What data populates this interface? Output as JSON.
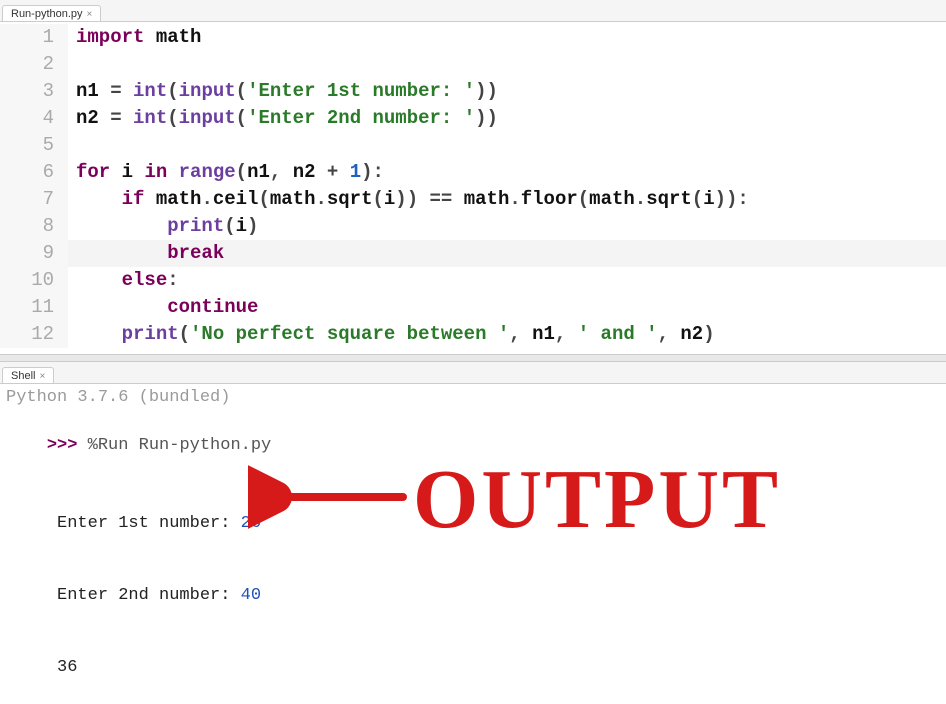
{
  "tabs": {
    "editor": {
      "label": "Run-python.py"
    },
    "shell": {
      "label": "Shell"
    }
  },
  "code": {
    "lines": [
      {
        "n": "1",
        "tokens": [
          [
            "kw",
            "import"
          ],
          [
            "id",
            " math"
          ]
        ]
      },
      {
        "n": "2",
        "tokens": []
      },
      {
        "n": "3",
        "tokens": [
          [
            "id",
            "n1 "
          ],
          [
            "op",
            "= "
          ],
          [
            "bi",
            "int"
          ],
          [
            "punc",
            "("
          ],
          [
            "bi",
            "input"
          ],
          [
            "punc",
            "("
          ],
          [
            "str",
            "'Enter 1st number: '"
          ],
          [
            "punc",
            "))"
          ]
        ]
      },
      {
        "n": "4",
        "tokens": [
          [
            "id",
            "n2 "
          ],
          [
            "op",
            "= "
          ],
          [
            "bi",
            "int"
          ],
          [
            "punc",
            "("
          ],
          [
            "bi",
            "input"
          ],
          [
            "punc",
            "("
          ],
          [
            "str",
            "'Enter 2nd number: '"
          ],
          [
            "punc",
            "))"
          ]
        ]
      },
      {
        "n": "5",
        "tokens": []
      },
      {
        "n": "6",
        "tokens": [
          [
            "kw",
            "for"
          ],
          [
            "id",
            " i "
          ],
          [
            "kw",
            "in"
          ],
          [
            "id",
            " "
          ],
          [
            "bi",
            "range"
          ],
          [
            "punc",
            "("
          ],
          [
            "id",
            "n1"
          ],
          [
            "punc",
            ", "
          ],
          [
            "id",
            "n2 "
          ],
          [
            "op",
            "+ "
          ],
          [
            "num",
            "1"
          ],
          [
            "punc",
            "):"
          ]
        ]
      },
      {
        "n": "7",
        "tokens": [
          [
            "id",
            "    "
          ],
          [
            "kw",
            "if"
          ],
          [
            "id",
            " math"
          ],
          [
            "punc",
            "."
          ],
          [
            "id",
            "ceil"
          ],
          [
            "punc",
            "("
          ],
          [
            "id",
            "math"
          ],
          [
            "punc",
            "."
          ],
          [
            "id",
            "sqrt"
          ],
          [
            "punc",
            "("
          ],
          [
            "id",
            "i"
          ],
          [
            "punc",
            ")) "
          ],
          [
            "op",
            "== "
          ],
          [
            "id",
            "math"
          ],
          [
            "punc",
            "."
          ],
          [
            "id",
            "floor"
          ],
          [
            "punc",
            "("
          ],
          [
            "id",
            "math"
          ],
          [
            "punc",
            "."
          ],
          [
            "id",
            "sqrt"
          ],
          [
            "punc",
            "("
          ],
          [
            "id",
            "i"
          ],
          [
            "punc",
            ")):"
          ]
        ]
      },
      {
        "n": "8",
        "tokens": [
          [
            "id",
            "        "
          ],
          [
            "bi",
            "print"
          ],
          [
            "punc",
            "("
          ],
          [
            "id",
            "i"
          ],
          [
            "punc",
            ")"
          ]
        ]
      },
      {
        "n": "9",
        "tokens": [
          [
            "id",
            "        "
          ],
          [
            "kw",
            "break"
          ]
        ],
        "hl": true
      },
      {
        "n": "10",
        "tokens": [
          [
            "id",
            "    "
          ],
          [
            "kw",
            "else"
          ],
          [
            "punc",
            ":"
          ]
        ]
      },
      {
        "n": "11",
        "tokens": [
          [
            "id",
            "        "
          ],
          [
            "kw",
            "continue"
          ]
        ]
      },
      {
        "n": "12",
        "tokens": [
          [
            "id",
            "    "
          ],
          [
            "bi",
            "print"
          ],
          [
            "punc",
            "("
          ],
          [
            "str",
            "'No perfect square between '"
          ],
          [
            "punc",
            ", "
          ],
          [
            "id",
            "n1"
          ],
          [
            "punc",
            ", "
          ],
          [
            "str",
            "' and '"
          ],
          [
            "punc",
            ", "
          ],
          [
            "id",
            "n2"
          ],
          [
            "punc",
            ")"
          ]
        ]
      }
    ]
  },
  "shell": {
    "banner": "Python 3.7.6 (bundled)",
    "prompt": ">>> ",
    "run_cmd": "%Run Run-python.py",
    "io": [
      {
        "prompt": " Enter 1st number: ",
        "value": "26"
      },
      {
        "prompt": " Enter 2nd number: ",
        "value": "40"
      }
    ],
    "output": " 36"
  },
  "annotation": {
    "text": "OUTPUT"
  }
}
